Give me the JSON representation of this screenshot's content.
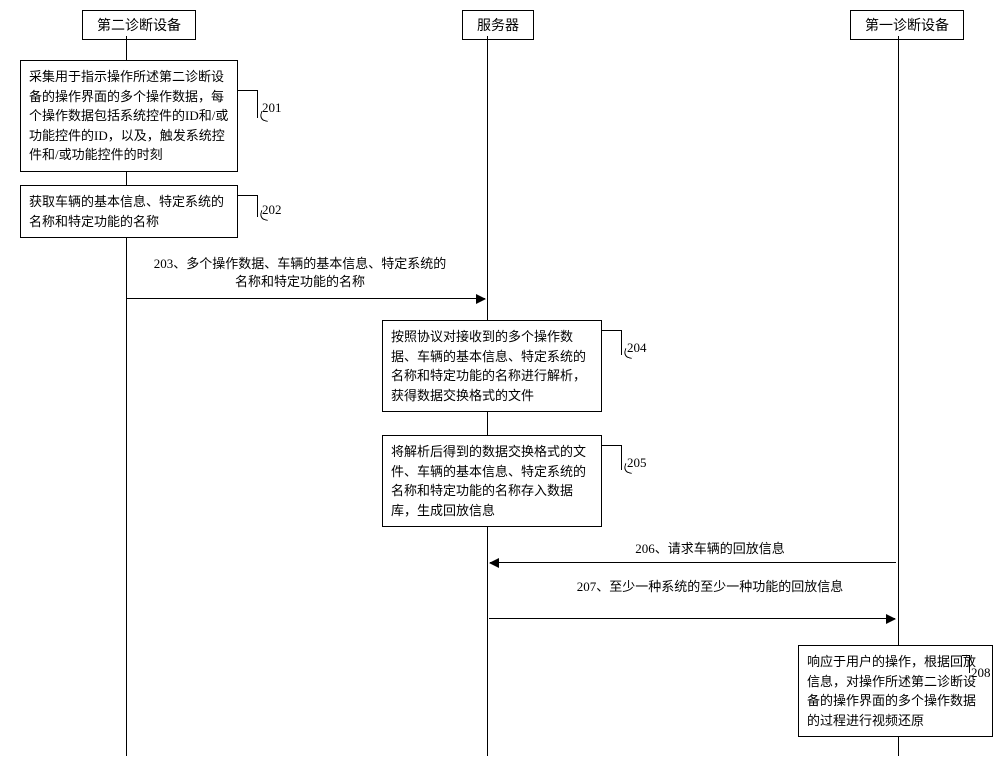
{
  "lanes": {
    "left": "第二诊断设备",
    "mid": "服务器",
    "right": "第一诊断设备"
  },
  "boxes": {
    "b201": "采集用于指示操作所述第二诊断设备的操作界面的多个操作数据，每个操作数据包括系统控件的ID和/或功能控件的ID，以及，触发系统控件和/或功能控件的时刻",
    "b202": "获取车辆的基本信息、特定系统的名称和特定功能的名称",
    "b204": "按照协议对接收到的多个操作数据、车辆的基本信息、特定系统的名称和特定功能的名称进行解析，获得数据交换格式的文件",
    "b205": "将解析后得到的数据交换格式的文件、车辆的基本信息、特定系统的名称和特定功能的名称存入数据库，生成回放信息",
    "b208": "响应于用户的操作，根据回放信息，对操作所述第二诊断设备的操作界面的多个操作数据的过程进行视频还原"
  },
  "steps": {
    "s201": "201",
    "s202": "202",
    "s204": "204",
    "s205": "205",
    "s208": "208"
  },
  "messages": {
    "m203": "203、多个操作数据、车辆的基本信息、特定系统的名称和特定功能的名称",
    "m206": "206、请求车辆的回放信息",
    "m207": "207、至少一种系统的至少一种功能的回放信息"
  }
}
